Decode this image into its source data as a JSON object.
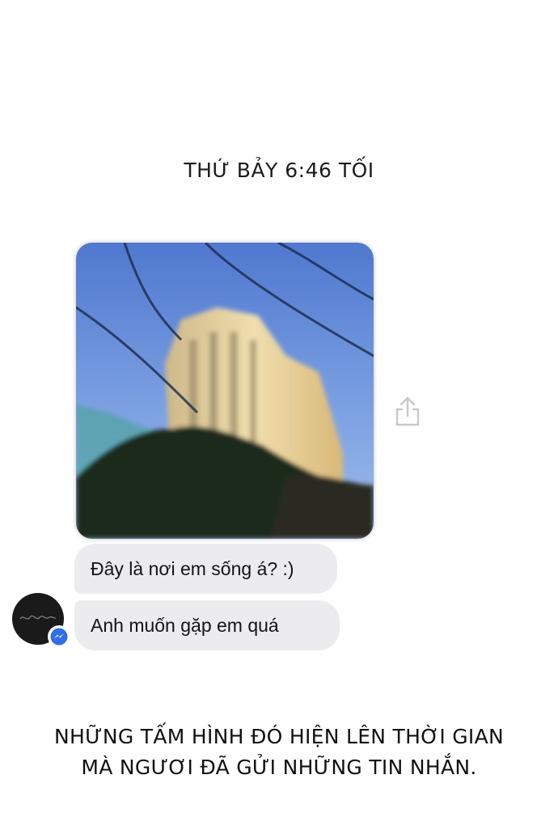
{
  "chat": {
    "timestamp": "THỨ BẢY 6:46 TỐI",
    "photo": {
      "description_icon": "photo-of-building"
    },
    "share_icon": "share-icon",
    "messages": [
      {
        "text": "Đây là nơi em sống á? :)"
      },
      {
        "text": "Anh muốn gặp em quá"
      }
    ],
    "avatar": {
      "icon": "avatar",
      "badge_icon": "messenger-icon"
    }
  },
  "caption": {
    "line1": "NHỮNG TẤM HÌNH ĐÓ HIỆN LÊN THỜI GIAN",
    "line2": "MÀ NGƯƠI ĐÃ GỬI NHỮNG TIN NHẮN."
  },
  "colors": {
    "bubble": "#ececee",
    "messenger_blue": "#2f6fe4",
    "sky": "#5b86d6"
  }
}
